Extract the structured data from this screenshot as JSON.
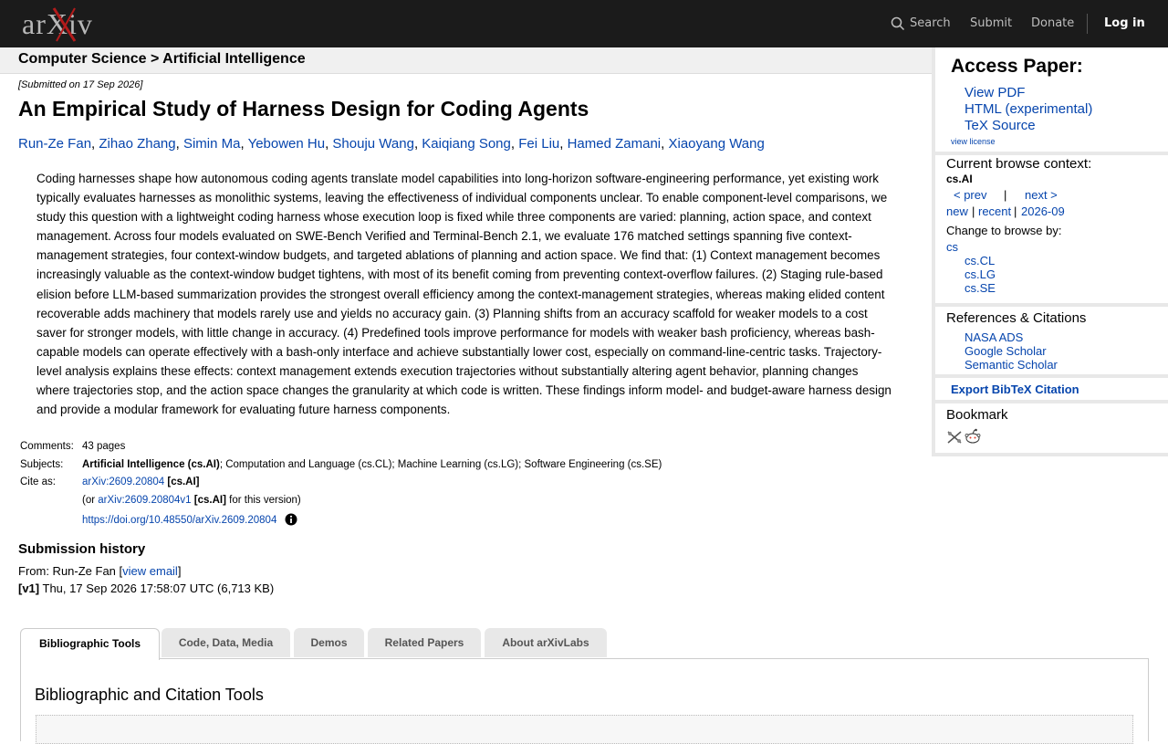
{
  "header": {
    "logo_text": "arXiv",
    "search_label": "Search",
    "submit_label": "Submit",
    "donate_label": "Donate",
    "login_label": "Log in"
  },
  "breadcrumb": {
    "parent": "Computer Science",
    "separator": ">",
    "current": "Artificial Intelligence"
  },
  "paper": {
    "submitted": "[Submitted on 17 Sep 2026]",
    "title": "An Empirical Study of Harness Design for Coding Agents",
    "authors": [
      "Run-Ze Fan",
      "Zihao Zhang",
      "Simin Ma",
      "Yebowen Hu",
      "Shouju Wang",
      "Kaiqiang Song",
      "Fei Liu",
      "Hamed Zamani",
      "Xiaoyang Wang"
    ],
    "abstract": "Coding harnesses shape how autonomous coding agents translate model capabilities into long-horizon software-engineering performance, yet existing work typically evaluates harnesses as monolithic systems, leaving the effectiveness of individual components unclear. To enable component-level comparisons, we study this question with a lightweight coding harness whose execution loop is fixed while three components are varied: planning, action space, and context management. Across four models evaluated on SWE-Bench Verified and Terminal-Bench 2.1, we evaluate 176 matched settings spanning five context-management strategies, four context-window budgets, and targeted ablations of planning and action space. We find that: (1) Context management becomes increasingly valuable as the context-window budget tightens, with most of its benefit coming from preventing context-overflow failures. (2) Staging rule-based elision before LLM-based summarization provides the strongest overall efficiency among the context-management strategies, whereas making elided content recoverable adds machinery that models rarely use and yields no accuracy gain. (3) Planning shifts from an accuracy scaffold for weaker models to a cost saver for stronger models, with little change in accuracy. (4) Predefined tools improve performance for models with weaker bash proficiency, whereas bash-capable models can operate effectively with a bash-only interface and achieve substantially lower cost, especially on command-line-centric tasks. Trajectory-level analysis explains these effects: context management extends execution trajectories without substantially altering agent behavior, planning changes where trajectories stop, and the action space changes the granularity at which code is written. These findings inform model- and budget-aware harness design and provide a modular framework for evaluating future harness components."
  },
  "metadata": {
    "comments_label": "Comments:",
    "comments_value": "43 pages",
    "subjects_label": "Subjects:",
    "subjects_primary": "Artificial Intelligence (cs.AI)",
    "subjects_rest": "; Computation and Language (cs.CL); Machine Learning (cs.LG); Software Engineering (cs.SE)",
    "cite_label": "Cite as:",
    "cite_id": "arXiv:2609.20804",
    "cite_tag": "[cs.AI]",
    "cite_v1_prefix": "(or",
    "cite_v1_id": "arXiv:2609.20804v1",
    "cite_v1_tag": "[cs.AI]",
    "cite_v1_suffix": "for this version)",
    "doi": "https://doi.org/10.48550/arXiv.2609.20804"
  },
  "submission_history": {
    "title": "Submission history",
    "from_prefix": "From: Run-Ze Fan [",
    "view_email": "view email",
    "from_suffix": "]",
    "v1_tag": "[v1]",
    "v1_text": "Thu, 17 Sep 2026 17:58:07 UTC (6,713 KB)"
  },
  "tabs": [
    {
      "label": "Bibliographic Tools",
      "active": true
    },
    {
      "label": "Code, Data, Media"
    },
    {
      "label": "Demos"
    },
    {
      "label": "Related Papers"
    },
    {
      "label": "About arXivLabs"
    }
  ],
  "tab_panel": {
    "heading": "Bibliographic and Citation Tools"
  },
  "sidebar": {
    "access_title": "Access Paper:",
    "view_pdf": "View PDF",
    "html": "HTML (experimental)",
    "tex": "TeX Source",
    "view_license": "view license",
    "context_title": "Current browse context:",
    "context_value": "cs.AI",
    "prev": "< prev",
    "pipe": "|",
    "next": "next >",
    "new": "new",
    "recent": "recent",
    "month": "2026-09",
    "change_title": "Change to browse by:",
    "browse": [
      "cs",
      "cs.CL",
      "cs.LG",
      "cs.SE"
    ],
    "refs_title": "References & Citations",
    "refs": [
      "NASA ADS",
      "Google Scholar",
      "Semantic Scholar"
    ],
    "export": "Export BibTeX Citation",
    "bookmark_title": "Bookmark"
  }
}
